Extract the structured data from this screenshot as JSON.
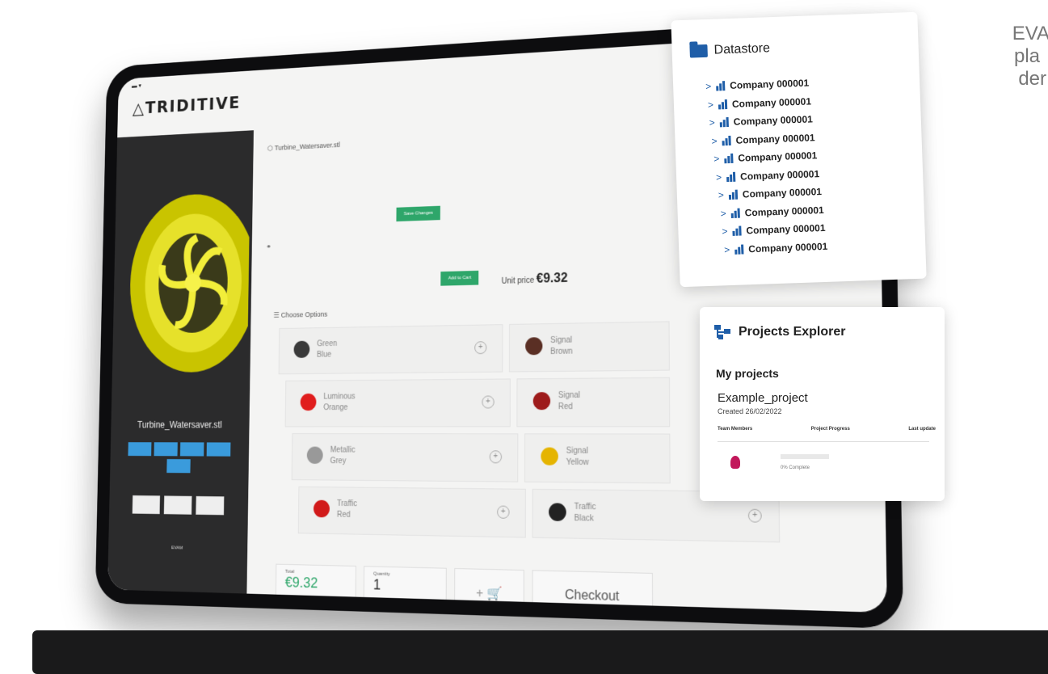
{
  "edge_text": [
    "EVA",
    "pla",
    "der"
  ],
  "app": {
    "brand": "TRIDITIVE",
    "file_name": "Turbine_Watersaver.stl",
    "buttons": {
      "primary": "Save Changes",
      "add_to_cart": "Add to Cart"
    },
    "unit_price_label": "Unit price",
    "unit_price": "€9.32",
    "options_title": "Choose Options",
    "options": [
      {
        "name": "Green\nBlue",
        "color": "#3a3a3a"
      },
      {
        "name": "Signal\nBrown",
        "color": "#5a2f24"
      },
      {
        "name": "Luminous\nOrange",
        "color": "#e01d1d"
      },
      {
        "name": "Signal\nRed",
        "color": "#9e1b1b"
      },
      {
        "name": "Metallic\nGrey",
        "color": "#999999"
      },
      {
        "name": "Signal\nYellow",
        "color": "#e5b400"
      },
      {
        "name": "Traffic\nRed",
        "color": "#d11a1a"
      },
      {
        "name": "Traffic\nBlack",
        "color": "#222222"
      }
    ],
    "total_label": "Total",
    "total": "€9.32",
    "quantity_label": "Quantity",
    "quantity": "1",
    "checkout": "Checkout",
    "footer_brand": "EVAM"
  },
  "datastore": {
    "title": "Datastore",
    "items": [
      "Company 000001",
      "Company 000001",
      "Company 000001",
      "Company 000001",
      "Company 000001",
      "Company 000001",
      "Company 000001",
      "Company 000001",
      "Company 000001",
      "Company 000001"
    ]
  },
  "projects": {
    "title": "Projects Explorer",
    "section": "My projects",
    "project_name": "Example_project",
    "created": "Created 26/02/2022",
    "columns": [
      "Team Members",
      "Project Progress",
      "Last update"
    ],
    "status": "0% Complete"
  },
  "colors": {
    "accent_blue": "#1f5ea8",
    "green": "#2ea66a"
  }
}
